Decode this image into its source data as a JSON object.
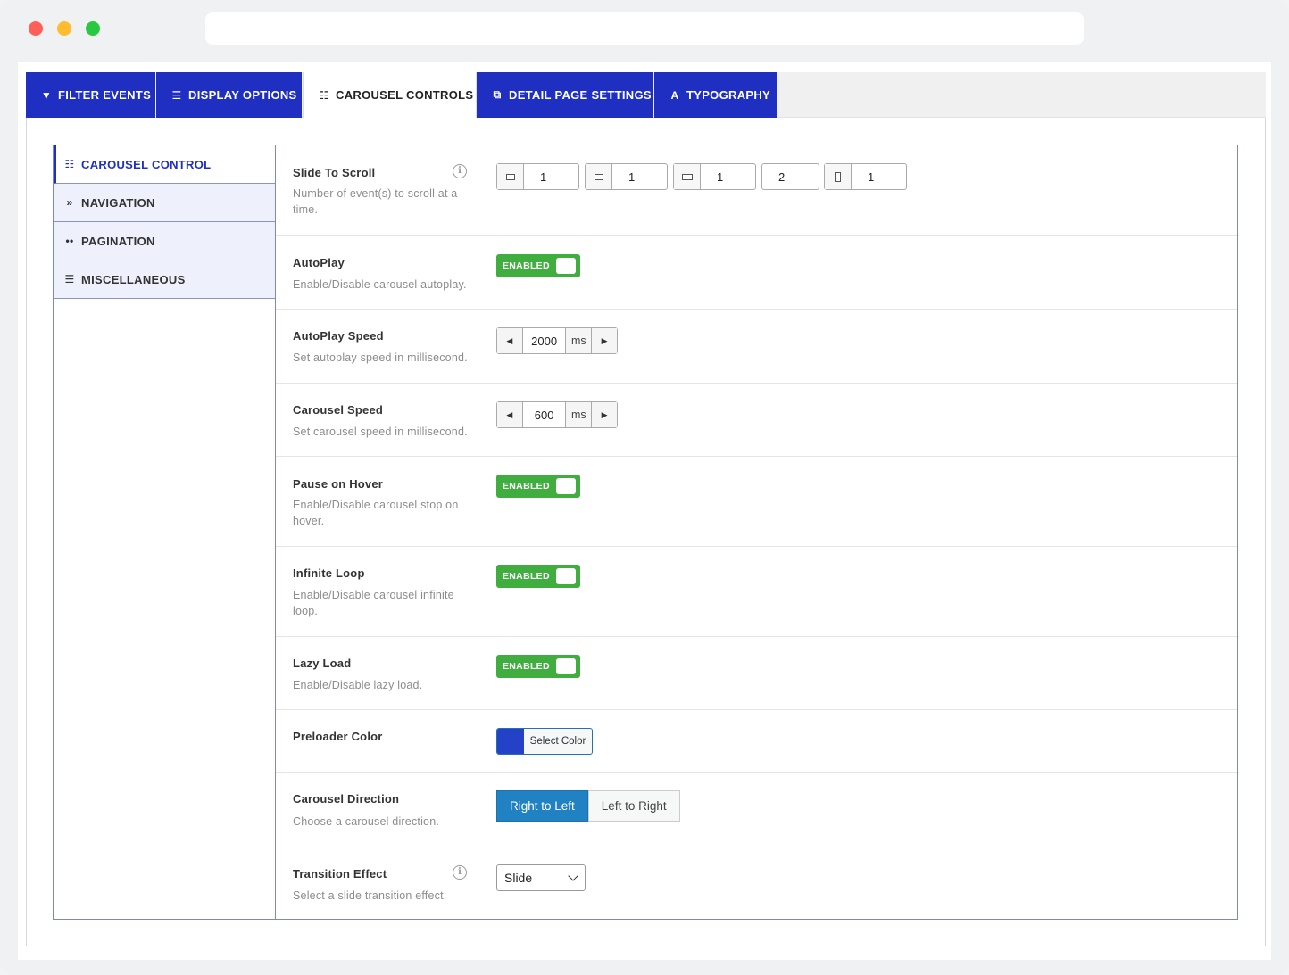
{
  "tabs": [
    {
      "label": "FILTER EVENTS",
      "icon": "filter-icon",
      "glyph": "▼"
    },
    {
      "label": "DISPLAY OPTIONS",
      "icon": "list-icon",
      "glyph": "☰"
    },
    {
      "label": "CAROUSEL CONTROLS",
      "icon": "sliders-icon",
      "glyph": "☷",
      "active": true
    },
    {
      "label": "DETAIL PAGE SETTINGS",
      "icon": "external-link-icon",
      "glyph": "⧉"
    },
    {
      "label": "TYPOGRAPHY",
      "icon": "font-icon",
      "glyph": "A"
    }
  ],
  "sidebar": {
    "items": [
      {
        "label": "CAROUSEL CONTROL",
        "icon": "sliders-icon",
        "glyph": "☷",
        "active": true
      },
      {
        "label": "NAVIGATION",
        "icon": "angle-double-right-icon",
        "glyph": "»"
      },
      {
        "label": "PAGINATION",
        "icon": "dots-icon",
        "glyph": "••"
      },
      {
        "label": "MISCELLANEOUS",
        "icon": "list-icon",
        "glyph": "☰"
      }
    ]
  },
  "settings": {
    "slide_to_scroll": {
      "title": "Slide To Scroll",
      "desc": "Number of event(s) to scroll at a time.",
      "values": [
        "1",
        "1",
        "1",
        "2",
        "1"
      ]
    },
    "autoplay": {
      "title": "AutoPlay",
      "desc": "Enable/Disable carousel autoplay.",
      "state": "ENABLED"
    },
    "autoplay_speed": {
      "title": "AutoPlay Speed",
      "desc": "Set autoplay speed in millisecond.",
      "value": "2000",
      "unit": "ms"
    },
    "carousel_speed": {
      "title": "Carousel Speed",
      "desc": "Set carousel speed in millisecond.",
      "value": "600",
      "unit": "ms"
    },
    "pause_on_hover": {
      "title": "Pause on Hover",
      "desc": "Enable/Disable carousel stop on hover.",
      "state": "ENABLED"
    },
    "infinite_loop": {
      "title": "Infinite Loop",
      "desc": "Enable/Disable carousel infinite loop.",
      "state": "ENABLED"
    },
    "lazy_load": {
      "title": "Lazy Load",
      "desc": "Enable/Disable lazy load.",
      "state": "ENABLED"
    },
    "preloader_color": {
      "title": "Preloader Color",
      "button": "Select Color",
      "color": "#2442c8"
    },
    "carousel_direction": {
      "title": "Carousel Direction",
      "desc": "Choose a carousel direction.",
      "options": [
        "Right to Left",
        "Left to Right"
      ],
      "selected": "Right to Left"
    },
    "transition_effect": {
      "title": "Transition Effect",
      "desc": "Select a slide transition effect.",
      "value": "Slide"
    }
  },
  "colors": {
    "brand": "#1f2fc2",
    "toggle_on": "#3fae3f",
    "selected_button": "#2081c3"
  }
}
